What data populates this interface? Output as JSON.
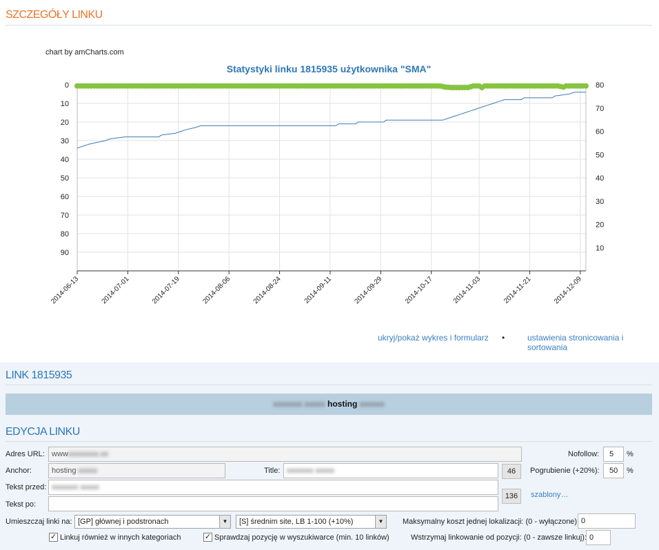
{
  "details_section": {
    "title": "SZCZEGÓŁY LINKU"
  },
  "chart_data": {
    "type": "line",
    "credit": "chart by amCharts.com",
    "title": "Statystyki linku 1815935 użytkownika \"SMA\"",
    "x_tick_labels": [
      "2014-06-13",
      "2014-07-01",
      "2014-07-19",
      "2014-08-06",
      "2014-08-24",
      "2014-09-11",
      "2014-09-29",
      "2014-10-17",
      "2014-11-03",
      "2014-11-21",
      "2014-12-09"
    ],
    "x_range": [
      "2014-06-13",
      "2014-12-11"
    ],
    "left_axis": {
      "reversed": true,
      "ylim": [
        0,
        100
      ],
      "ticks": [
        0,
        10,
        20,
        30,
        40,
        50,
        60,
        70,
        80,
        90
      ]
    },
    "right_axis": {
      "ylim": [
        0,
        80
      ],
      "ticks": [
        10,
        20,
        30,
        40,
        50,
        60,
        70,
        80
      ]
    },
    "grid": true,
    "series": [
      {
        "axis": "left",
        "color": "#3b7ab4",
        "points": [
          [
            "2014-06-13",
            34
          ],
          [
            "2014-06-15",
            33
          ],
          [
            "2014-06-17",
            32
          ],
          [
            "2014-06-23",
            30
          ],
          [
            "2014-06-25",
            29
          ],
          [
            "2014-06-30",
            28
          ],
          [
            "2014-07-12",
            28
          ],
          [
            "2014-07-13",
            27
          ],
          [
            "2014-07-18",
            26
          ],
          [
            "2014-07-20",
            25
          ],
          [
            "2014-07-22",
            24
          ],
          [
            "2014-07-25",
            23
          ],
          [
            "2014-07-27",
            22
          ],
          [
            "2014-09-13",
            22
          ],
          [
            "2014-09-14",
            21
          ],
          [
            "2014-09-20",
            21
          ],
          [
            "2014-09-21",
            20
          ],
          [
            "2014-09-30",
            20
          ],
          [
            "2014-10-01",
            19
          ],
          [
            "2014-10-21",
            19
          ],
          [
            "2014-10-23",
            18
          ],
          [
            "2014-10-25",
            17
          ],
          [
            "2014-10-27",
            16
          ],
          [
            "2014-10-29",
            15
          ],
          [
            "2014-10-31",
            14
          ],
          [
            "2014-11-02",
            13
          ],
          [
            "2014-11-04",
            12
          ],
          [
            "2014-11-06",
            11
          ],
          [
            "2014-11-08",
            10
          ],
          [
            "2014-11-10",
            9
          ],
          [
            "2014-11-12",
            8
          ],
          [
            "2014-11-18",
            8
          ],
          [
            "2014-11-19",
            7
          ],
          [
            "2014-11-29",
            7
          ],
          [
            "2014-11-30",
            6
          ],
          [
            "2014-12-05",
            5
          ],
          [
            "2014-12-07",
            4
          ],
          [
            "2014-12-11",
            4
          ]
        ]
      },
      {
        "axis": "right",
        "color": "#86c440",
        "points": [
          [
            "2014-06-13",
            79.5
          ],
          [
            "2014-10-20",
            79.5
          ],
          [
            "2014-10-22",
            79.0
          ],
          [
            "2014-10-24",
            78.8
          ],
          [
            "2014-10-26",
            78.8
          ],
          [
            "2014-10-28",
            78.8
          ],
          [
            "2014-10-30",
            78.8
          ],
          [
            "2014-11-01",
            79.5
          ],
          [
            "2014-11-03",
            79.5
          ],
          [
            "2014-11-04",
            78.8
          ],
          [
            "2014-11-05",
            79.5
          ],
          [
            "2014-12-01",
            79.5
          ],
          [
            "2014-12-03",
            79.0
          ],
          [
            "2014-12-04",
            79.5
          ],
          [
            "2014-12-11",
            79.5
          ]
        ]
      }
    ]
  },
  "links_row": {
    "toggle_label": "ukryj/pokaż wykres i formularz",
    "separator": "•",
    "settings_label": "ustawienia stronicowania i sortowania"
  },
  "link_section": {
    "title": "LINK 1815935",
    "bar_text": "hosting"
  },
  "edit_section": {
    "title": "EDYCJA LINKU",
    "url_label": "Adres URL:",
    "url_value": "www",
    "anchor_label": "Anchor:",
    "anchor_value": "hosting",
    "title_label": "Title:",
    "count_46": "46",
    "text_before_label": "Tekst przed:",
    "text_after_label": "Tekst po:",
    "count_136": "136",
    "templates_link": "szablony…",
    "nofollow_label": "Nofollow:",
    "nofollow_value": "5",
    "bold_label": "Pogrubienie (+20%):",
    "bold_value": "50",
    "percent": "%",
    "placement_label": "Umieszczaj linki na:",
    "placement_select": "[GP] głównej i podstronach",
    "site_select": "[S] średnim site, LB 1-100 (+10%)",
    "max_cost_label": "Maksymalny koszt jednej lokalizacji: (0 - wyłączone)",
    "max_cost_value": "0",
    "cb_other_categories": "Linkuj również w innych kategoriach",
    "cb_check_position": "Sprawdzaj pozycję w wyszukiwarce (min. 10 linków)",
    "stop_label": "Wstrzymaj linkowanie od pozycji: (0 - zawsze linkuj):",
    "stop_value": "0",
    "checkmark": "✓"
  }
}
